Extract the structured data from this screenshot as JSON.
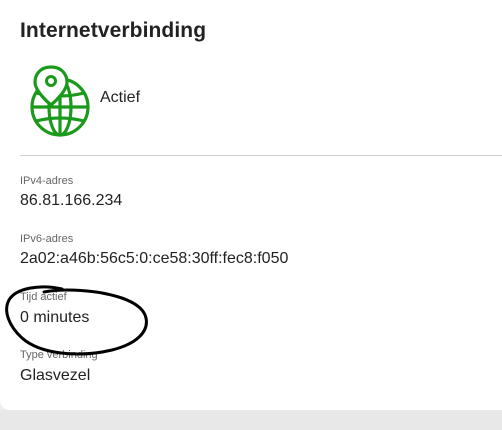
{
  "card": {
    "title": "Internetverbinding",
    "status": "Actief",
    "status_icon": "globe-location-pin-icon",
    "accent_color": "#1a9a1a"
  },
  "fields": [
    {
      "label": "IPv4-adres",
      "value": "86.81.166.234"
    },
    {
      "label": "IPv6-adres",
      "value": "2a02:a46b:56c5:0:ce58:30ff:fec8:f050"
    },
    {
      "label": "Tijd actief",
      "value": "0 minutes"
    },
    {
      "label": "Type verbinding",
      "value": "Glasvezel"
    }
  ]
}
